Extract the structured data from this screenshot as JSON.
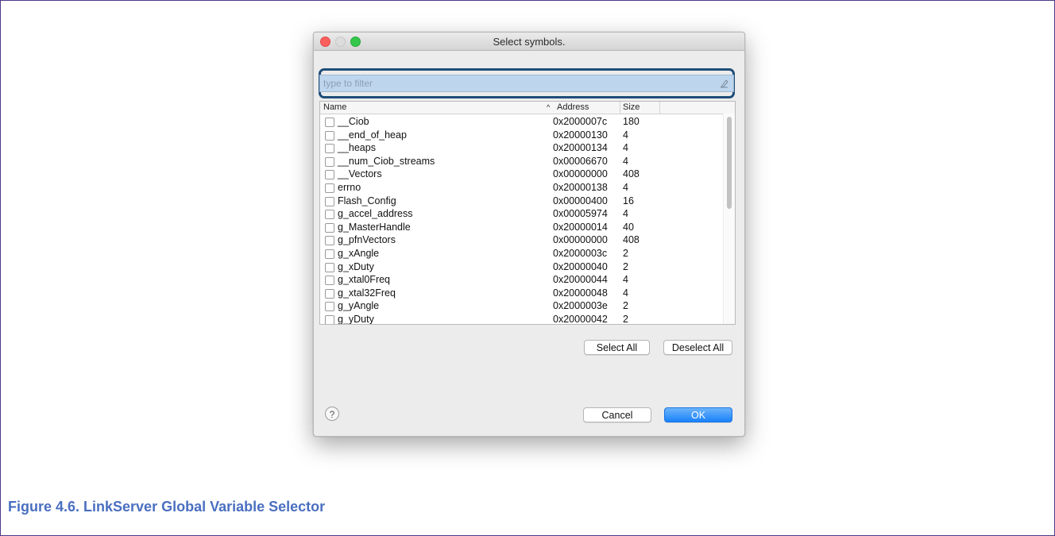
{
  "dialog": {
    "title": "Select symbols.",
    "filter": {
      "placeholder": "type to filter",
      "value": ""
    },
    "columns": {
      "name": "Name",
      "address": "Address",
      "size": "Size",
      "sort_indicator": "^"
    },
    "rows": [
      {
        "name": "__Ciob",
        "address": "0x2000007c",
        "size": "180"
      },
      {
        "name": "__end_of_heap",
        "address": "0x20000130",
        "size": "4"
      },
      {
        "name": "__heaps",
        "address": "0x20000134",
        "size": "4"
      },
      {
        "name": "__num_Ciob_streams",
        "address": "0x00006670",
        "size": "4"
      },
      {
        "name": "__Vectors",
        "address": "0x00000000",
        "size": "408"
      },
      {
        "name": "errno",
        "address": "0x20000138",
        "size": "4"
      },
      {
        "name": "Flash_Config",
        "address": "0x00000400",
        "size": "16"
      },
      {
        "name": "g_accel_address",
        "address": "0x00005974",
        "size": "4"
      },
      {
        "name": "g_MasterHandle",
        "address": "0x20000014",
        "size": "40"
      },
      {
        "name": "g_pfnVectors",
        "address": "0x00000000",
        "size": "408"
      },
      {
        "name": "g_xAngle",
        "address": "0x2000003c",
        "size": "2"
      },
      {
        "name": "g_xDuty",
        "address": "0x20000040",
        "size": "2"
      },
      {
        "name": "g_xtal0Freq",
        "address": "0x20000044",
        "size": "4"
      },
      {
        "name": "g_xtal32Freq",
        "address": "0x20000048",
        "size": "4"
      },
      {
        "name": "g_yAngle",
        "address": "0x2000003e",
        "size": "2"
      },
      {
        "name": "g_yDuty",
        "address": "0x20000042",
        "size": "2"
      }
    ],
    "buttons": {
      "select_all": "Select All",
      "deselect_all": "Deselect All",
      "cancel": "Cancel",
      "ok": "OK",
      "help": "?"
    },
    "icons": {
      "clear": "clear-filter-icon",
      "help": "help-icon"
    },
    "colors": {
      "ok_button": "#1a82fb",
      "filter_bg": "#bdd6ee",
      "highlight_border": "#1f4e79"
    }
  },
  "caption": "Figure 4.6. LinkServer Global Variable Selector"
}
